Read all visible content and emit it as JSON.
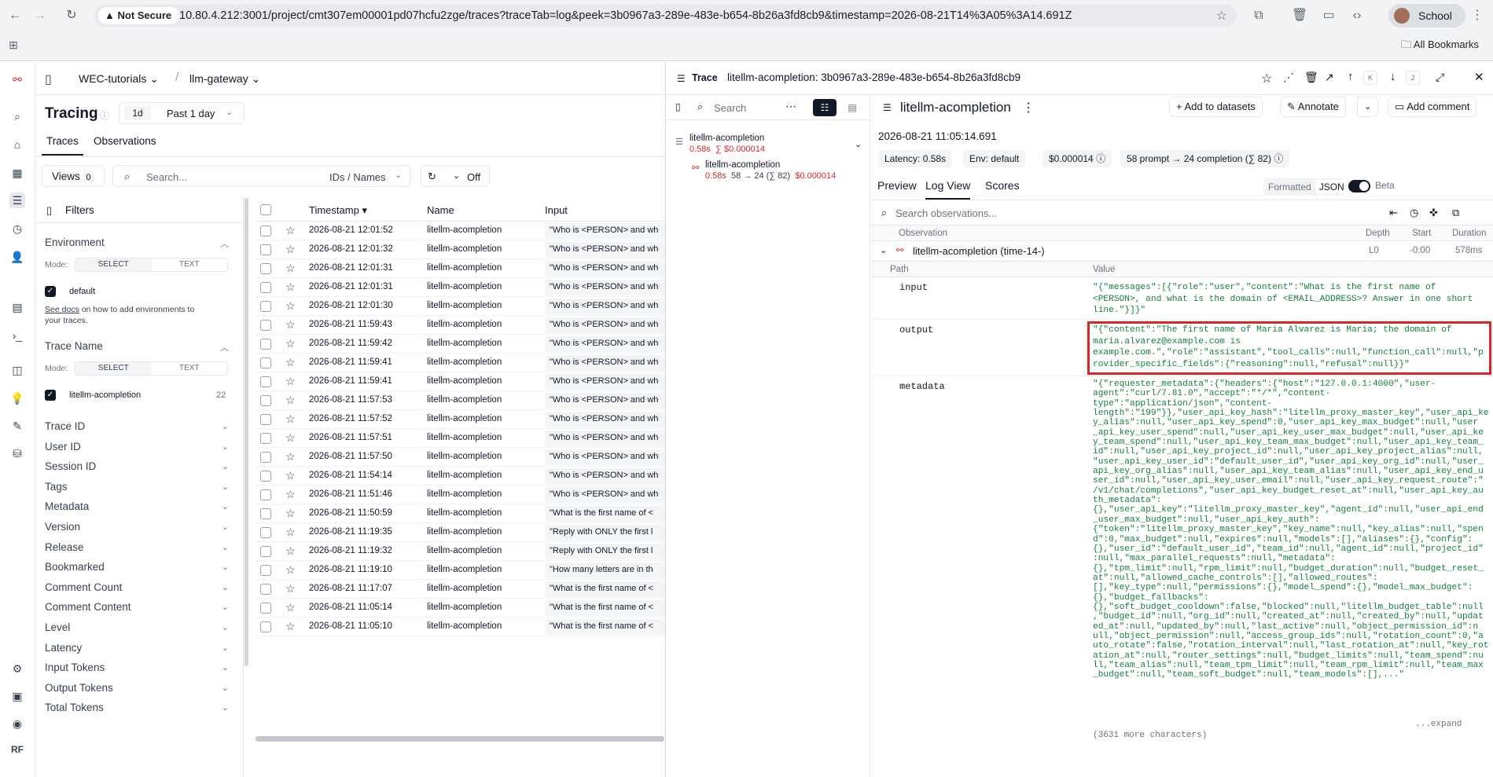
{
  "browser": {
    "security": "Not Secure",
    "url": "10.80.4.212:3001/project/cmt307em00001pd07hcfu2zge/traces?traceTab=log&peek=3b0967a3-289e-483e-b654-8b26a3fd8cb9&timestamp=2026-08-21T14%3A05%3A14.691Z",
    "profile": "School",
    "bookmarks": "All Bookmarks"
  },
  "breadcrumb": {
    "org": "WEC-tutorials",
    "project": "llm-gateway"
  },
  "page": {
    "title": "Tracing",
    "range_short": "1d",
    "range": "Past 1 day",
    "tabs": [
      "Traces",
      "Observations"
    ],
    "views": "Views",
    "views_count": "0",
    "search_placeholder": "Search...",
    "search_mode": "IDs / Names",
    "refresh": "Off"
  },
  "filters": {
    "title": "Filters",
    "env_label": "Environment",
    "mode": "Mode:",
    "select": "SELECT",
    "text": "TEXT",
    "env_value": "default",
    "docs_link": "See docs",
    "docs_text": " on how to add environments to your traces.",
    "trace_name": "Trace Name",
    "trace_value": "litellm-acompletion",
    "trace_count": "22",
    "sections": [
      "Trace ID",
      "User ID",
      "Session ID",
      "Tags",
      "Metadata",
      "Version",
      "Release",
      "Bookmarked",
      "Comment Count",
      "Comment Content",
      "Level",
      "Latency",
      "Input Tokens",
      "Output Tokens",
      "Total Tokens"
    ]
  },
  "table": {
    "headers": [
      "Timestamp",
      "Name",
      "Input"
    ],
    "rows": [
      {
        "ts": "2026-08-21 12:01:52",
        "name": "litellm-acompletion",
        "input": "\"Who is <PERSON> and wh"
      },
      {
        "ts": "2026-08-21 12:01:32",
        "name": "litellm-acompletion",
        "input": "\"Who is <PERSON> and wh"
      },
      {
        "ts": "2026-08-21 12:01:31",
        "name": "litellm-acompletion",
        "input": "\"Who is <PERSON> and wh"
      },
      {
        "ts": "2026-08-21 12:01:31",
        "name": "litellm-acompletion",
        "input": "\"Who is <PERSON> and wh"
      },
      {
        "ts": "2026-08-21 12:01:30",
        "name": "litellm-acompletion",
        "input": "\"Who is <PERSON> and wh"
      },
      {
        "ts": "2026-08-21 11:59:43",
        "name": "litellm-acompletion",
        "input": "\"Who is <PERSON> and wh"
      },
      {
        "ts": "2026-08-21 11:59:42",
        "name": "litellm-acompletion",
        "input": "\"Who is <PERSON> and wh"
      },
      {
        "ts": "2026-08-21 11:59:41",
        "name": "litellm-acompletion",
        "input": "\"Who is <PERSON> and wh"
      },
      {
        "ts": "2026-08-21 11:59:41",
        "name": "litellm-acompletion",
        "input": "\"Who is <PERSON> and wh"
      },
      {
        "ts": "2026-08-21 11:57:53",
        "name": "litellm-acompletion",
        "input": "\"Who is <PERSON> and wh"
      },
      {
        "ts": "2026-08-21 11:57:52",
        "name": "litellm-acompletion",
        "input": "\"Who is <PERSON> and wh"
      },
      {
        "ts": "2026-08-21 11:57:51",
        "name": "litellm-acompletion",
        "input": "\"Who is <PERSON> and wh"
      },
      {
        "ts": "2026-08-21 11:57:50",
        "name": "litellm-acompletion",
        "input": "\"Who is <PERSON> and wh"
      },
      {
        "ts": "2026-08-21 11:54:14",
        "name": "litellm-acompletion",
        "input": "\"Who is <PERSON> and wh"
      },
      {
        "ts": "2026-08-21 11:51:46",
        "name": "litellm-acompletion",
        "input": "\"Who is <PERSON> and wh"
      },
      {
        "ts": "2026-08-21 11:50:59",
        "name": "litellm-acompletion",
        "input": "\"What is the first name of <"
      },
      {
        "ts": "2026-08-21 11:19:35",
        "name": "litellm-acompletion",
        "input": "\"Reply with ONLY the first l"
      },
      {
        "ts": "2026-08-21 11:19:32",
        "name": "litellm-acompletion",
        "input": "\"Reply with ONLY the first l"
      },
      {
        "ts": "2026-08-21 11:19:10",
        "name": "litellm-acompletion",
        "input": "\"How many letters are in th"
      },
      {
        "ts": "2026-08-21 11:17:07",
        "name": "litellm-acompletion",
        "input": "\"What is the first name of <"
      },
      {
        "ts": "2026-08-21 11:05:14",
        "name": "litellm-acompletion",
        "input": "\"What is the first name of <"
      },
      {
        "ts": "2026-08-21 11:05:10",
        "name": "litellm-acompletion",
        "input": "\"What is the first name of <"
      }
    ]
  },
  "trace": {
    "label": "Trace",
    "title": "litellm-acompletion: 3b0967a3-289e-483e-b654-8b26a3fd8cb9",
    "key_k": "K",
    "key_j": "J",
    "search": "Search",
    "tree": {
      "root": "litellm-acompletion",
      "root_lat": "0.58s",
      "root_cost": "∑ $0.000014",
      "child": "litellm-acompletion",
      "child_lat": "0.58s",
      "child_tokens": "58 → 24 (∑ 82)",
      "child_cost": "$0.000014"
    },
    "name": "litellm-acompletion",
    "add_datasets": "Add to datasets",
    "annotate": "Annotate",
    "add_comment": "Add comment",
    "time": "2026-08-21 11:05:14.691",
    "chips": [
      "Latency: 0.58s",
      "Env: default",
      "$0.000014",
      "58 prompt → 24 completion (∑ 82)"
    ],
    "tabs": [
      "Preview",
      "Log View",
      "Scores"
    ],
    "formatted": "Formatted",
    "json": "JSON",
    "beta": "Beta",
    "obs_search": "Search observations...",
    "cols": [
      "Observation",
      "Depth",
      "Start",
      "Duration"
    ],
    "obs_name": "litellm-acompletion (time-14-)",
    "obs_depth": "L0",
    "obs_start": "-0:00",
    "obs_dur": "578ms",
    "path": "Path",
    "value": "Value",
    "input_key": "input",
    "input_val": "\"{\"messages\":[{\"role\":\"user\",\"content\":\"What is the first name of\n<PERSON>, and what is the domain of <EMAIL_ADDRESS>? Answer in one short\nline.\"}]}\"",
    "output_key": "output",
    "output_val": "\"{\"content\":\"The first name of Maria Alvarez is Maria; the domain of\nmaria.alvarez@example.com is\nexample.com.\",\"role\":\"assistant\",\"tool_calls\":null,\"function_call\":null,\"p\nrovider_specific_fields\":{\"reasoning\":null,\"refusal\":null}}\"",
    "metadata_key": "metadata",
    "metadata_val": "\"{\"requester_metadata\":{\"headers\":{\"host\":\"127.0.0.1:4000\",\"user-\nagent\":\"curl/7.81.0\",\"accept\":\"*/*\",\"content-\ntype\":\"application/json\",\"content-\nlength\":\"199\"}},\"user_api_key_hash\":\"litellm_proxy_master_key\",\"user_api_ke\ny_alias\":null,\"user_api_key_spend\":0,\"user_api_key_max_budget\":null,\"user\n_api_key_user_spend\":null,\"user_api_key_user_max_budget\":null,\"user_api_ke\ny_team_spend\":null,\"user_api_key_team_max_budget\":null,\"user_api_key_team_\nid\":null,\"user_api_key_project_id\":null,\"user_api_key_project_alias\":null,\n\"user_api_key_user_id\":\"default_user_id\",\"user_api_key_org_id\":null,\"user_\napi_key_org_alias\":null,\"user_api_key_team_alias\":null,\"user_api_key_end_u\nser_id\":null,\"user_api_key_user_email\":null,\"user_api_key_request_route\":\"\n/v1/chat/completions\",\"user_api_key_budget_reset_at\":null,\"user_api_key_au\nth_metadata\":\n{},\"user_api_key\":\"litellm_proxy_master_key\",\"agent_id\":null,\"user_api_end\n_user_max_budget\":null,\"user_api_key_auth\":\n{\"token\":\"litellm_proxy_master_key\",\"key_name\":null,\"key_alias\":null,\"spen\nd\":0,\"max_budget\":null,\"expires\":null,\"models\":[],\"aliases\":{},\"config\":\n{},\"user_id\":\"default_user_id\",\"team_id\":null,\"agent_id\":null,\"project_id\"\n:null,\"max_parallel_requests\":null,\"metadata\":\n{},\"tpm_limit\":null,\"rpm_limit\":null,\"budget_duration\":null,\"budget_reset_\nat\":null,\"allowed_cache_controls\":[],\"allowed_routes\":\n[],\"key_type\":null,\"permissions\":{},\"model_spend\":{},\"model_max_budget\":\n{},\"budget_fallbacks\":\n{},\"soft_budget_cooldown\":false,\"blocked\":null,\"litellm_budget_table\":null\n,\"budget_id\":null,\"org_id\":null,\"created_at\":null,\"created_by\":null,\"updat\ned_at\":null,\"updated_by\":null,\"last_active\":null,\"object_permission_id\":n\null,\"object_permission\":null,\"access_group_ids\":null,\"rotation_count\":0,\"a\nuto_rotate\":false,\"rotation_interval\":null,\"last_rotation_at\":null,\"key_rot\nation_at\":null,\"router_settings\":null,\"budget_limits\":null,\"team_spend\":nu\nll,\"team_alias\":null,\"team_tpm_limit\":null,\"team_rpm_limit\":null,\"team_max\n_budget\":null,\"team_soft_budget\":null,\"team_models\":[],...\"",
    "expand": "...expand",
    "more": "(3631 more characters)"
  }
}
